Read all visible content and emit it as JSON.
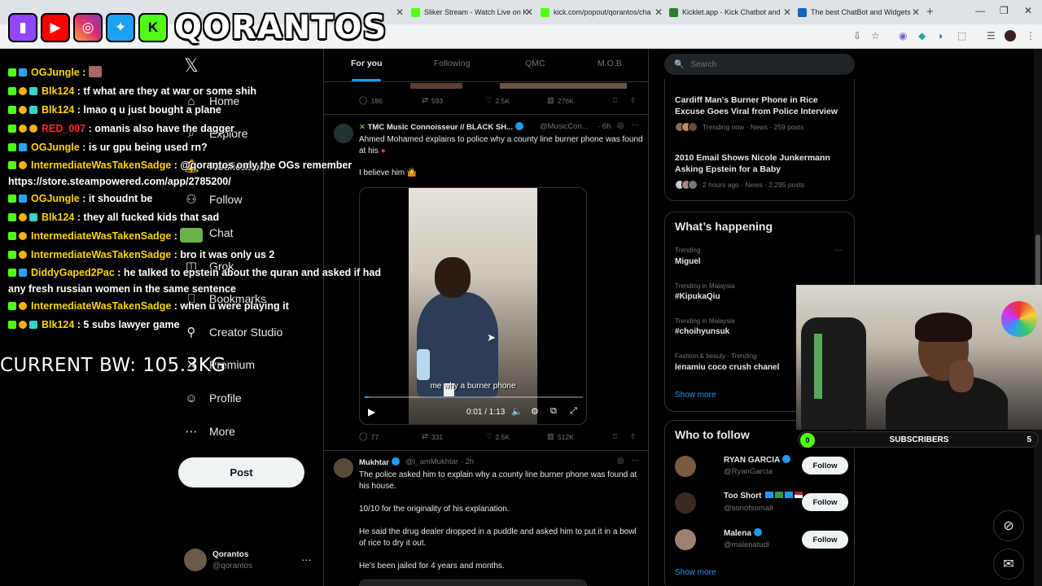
{
  "browser": {
    "tabs": [
      {
        "title": "Sliker Stream - Watch Live on K",
        "color": "#53fc18"
      },
      {
        "title": "kick.com/popout/qorantos/cha",
        "color": "#53fc18"
      },
      {
        "title": "Kicklet.app - Kick Chatbot and",
        "color": "#2e7d32"
      },
      {
        "title": "The best ChatBot and Widgets",
        "color": "#1565c0"
      }
    ]
  },
  "stream": {
    "channel_name": "QORANTOS",
    "social_icons": [
      "twitch-icon",
      "youtube-icon",
      "instagram-icon",
      "twitter-icon",
      "kick-icon"
    ],
    "bw_label": "CURRENT BW: 105.3KG",
    "chat": [
      {
        "user": "OGJungle",
        "msg": " : ",
        "user_color": "#ffd400"
      },
      {
        "user": "Blk124",
        "msg": " : tf what are they at war or some shih",
        "user_color": "#ffd400"
      },
      {
        "user": "Blk124",
        "msg": " : lmao q u just bought a plane",
        "user_color": "#ffd400"
      },
      {
        "user": "RED_007",
        "msg": " : omanis also have the dagger",
        "user_color": "#ff2a2a"
      },
      {
        "user": "OGJungle",
        "msg": " : is ur gpu being used rn?",
        "user_color": "#ffd400"
      },
      {
        "user": "IntermediateWasTakenSadge",
        "msg": " : @qorantos only the OGs remember https://store.steampowered.com/app/2785200/",
        "user_color": "#ffd400"
      },
      {
        "user": "OGJungle",
        "msg": " : it shoudnt be",
        "user_color": "#ffd400"
      },
      {
        "user": "Blk124",
        "msg": " : they all fucked kids that sad",
        "user_color": "#ffd400"
      },
      {
        "user": "IntermediateWasTakenSadge",
        "msg": " : ",
        "user_color": "#ffd400"
      },
      {
        "user": "IntermediateWasTakenSadge",
        "msg": " : bro it was only us 2",
        "user_color": "#ffd400"
      },
      {
        "user": "DiddyGaped2Pac",
        "msg": " : he talked to epstein about the quran and asked if had any fresh russian women in the same sentence",
        "user_color": "#ffd400"
      },
      {
        "user": "IntermediateWasTakenSadge",
        "msg": " : when u were playing it",
        "user_color": "#ffd400"
      },
      {
        "user": "Blk124",
        "msg": " : 5 subs lawyer game",
        "user_color": "#ffd400"
      }
    ],
    "subs": {
      "current": "0",
      "label": "SUBSCRIBERS",
      "goal": "5"
    }
  },
  "x_nav": {
    "items": [
      {
        "label": "Home",
        "icon": "home-icon"
      },
      {
        "label": "Explore",
        "icon": "search-icon"
      },
      {
        "label": "Notifications",
        "icon": "bell-icon"
      },
      {
        "label": "Follow",
        "icon": "follow-icon"
      },
      {
        "label": "Chat",
        "icon": "chat-icon"
      },
      {
        "label": "Grok",
        "icon": "grok-icon"
      },
      {
        "label": "Bookmarks",
        "icon": "bookmark-icon"
      },
      {
        "label": "Creator Studio",
        "icon": "creator-icon"
      },
      {
        "label": "Premium",
        "icon": "premium-icon"
      },
      {
        "label": "Profile",
        "icon": "profile-icon"
      },
      {
        "label": "More",
        "icon": "more-icon"
      }
    ],
    "post_button": "Post",
    "account": {
      "name": "Qorantos",
      "handle": "@qorantos"
    }
  },
  "feed": {
    "tabs": [
      "For you",
      "Following",
      "QMC",
      "M.O.B"
    ],
    "prev_tweet_actions": {
      "replies": "186",
      "reposts": "593",
      "likes": "2.5K",
      "views": "276K"
    },
    "tweet1": {
      "name": "TMC Music Connoisseur // BLACK SH...",
      "handle": "@MusicCon...",
      "time": "· 6h",
      "text": "Ahmed Mohamed explains to police why a county line burner phone was found at his",
      "text2": "I believe him",
      "video": {
        "subtitle": "me why a burner phone",
        "time": "0:01 / 1:13",
        "progress": 0.02
      },
      "actions": {
        "replies": "77",
        "reposts": "331",
        "likes": "2.5K",
        "views": "512K"
      }
    },
    "tweet2": {
      "name": "Mukhtar",
      "handle": "@I_amMukhtar · 2h",
      "p1": "The police asked him to explain why a county line burner phone was found at his house.",
      "p2": "10/10 for the originality of his explanation.",
      "p3": "He said the drug dealer dropped in a puddle and asked him to put it in a bowl of rice to dry it out.",
      "p4": "He's been jailed for 4 years and months."
    }
  },
  "right": {
    "search_placeholder": "Search",
    "news": [
      {
        "title": "Cardiff Man's Burner Phone in Rice Excuse Goes Viral from Police Interview",
        "meta": "Trending now · News · 259 posts"
      },
      {
        "title": "2010 Email Shows Nicole Junkermann Asking Epstein for a Baby",
        "meta": "2 hours ago · News · 2,295 posts"
      }
    ],
    "happening_title": "What’s happening",
    "trends": [
      {
        "context": "Trending",
        "tag": "Miguel"
      },
      {
        "context": "Trending in Malaysia",
        "tag": "#KipukaQiu"
      },
      {
        "context": "Trending in Malaysia",
        "tag": "#choihyunsuk"
      },
      {
        "context": "Fashion & beauty · Trending",
        "tag": "lenamiu coco crush chanel"
      }
    ],
    "show_more": "Show more",
    "who_title": "Who to follow",
    "who": [
      {
        "name": "RYAN GARCIA",
        "handle": "@RyanGarcia"
      },
      {
        "name": "Too Short",
        "handle": "@sonofsomall"
      },
      {
        "name": "Malena",
        "handle": "@malenatudi"
      }
    ],
    "follow_label": "Follow"
  }
}
